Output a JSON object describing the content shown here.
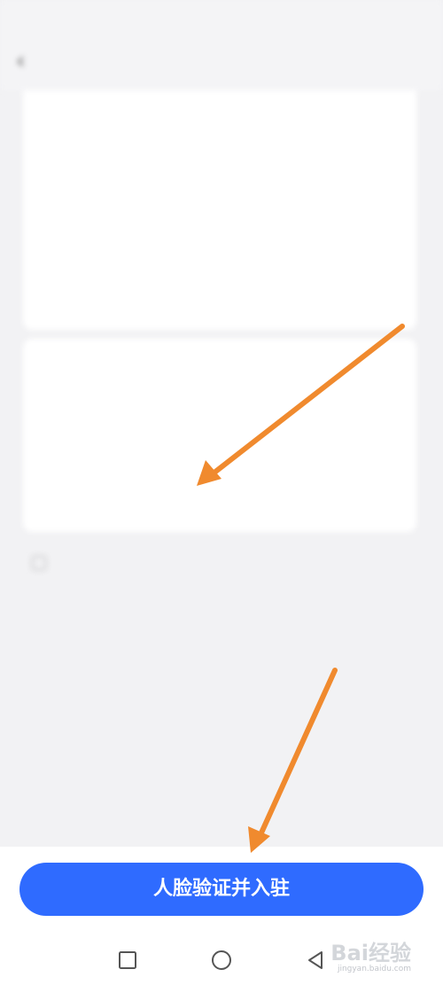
{
  "status_bar": {
    "time": "",
    "icons": ""
  },
  "nav": {
    "title": ""
  },
  "section_id": {
    "title": "",
    "name_label": "",
    "name_value": "",
    "id_label": "",
    "id_value": ""
  },
  "section_store": {
    "title": "",
    "store_name_label": "",
    "store_name_placeholder": "",
    "store_type_label": ""
  },
  "agreement": {
    "prefix": "",
    "links": [
      "",
      "",
      ""
    ]
  },
  "primary_button": {
    "label": "人脸验证并入驻"
  },
  "watermark": {
    "text": "Bai经验",
    "sub": "jingyan.baidu.com"
  },
  "colors": {
    "accent": "#2f6bff",
    "arrow": "#f08a2e",
    "link": "#2d4ea8"
  }
}
